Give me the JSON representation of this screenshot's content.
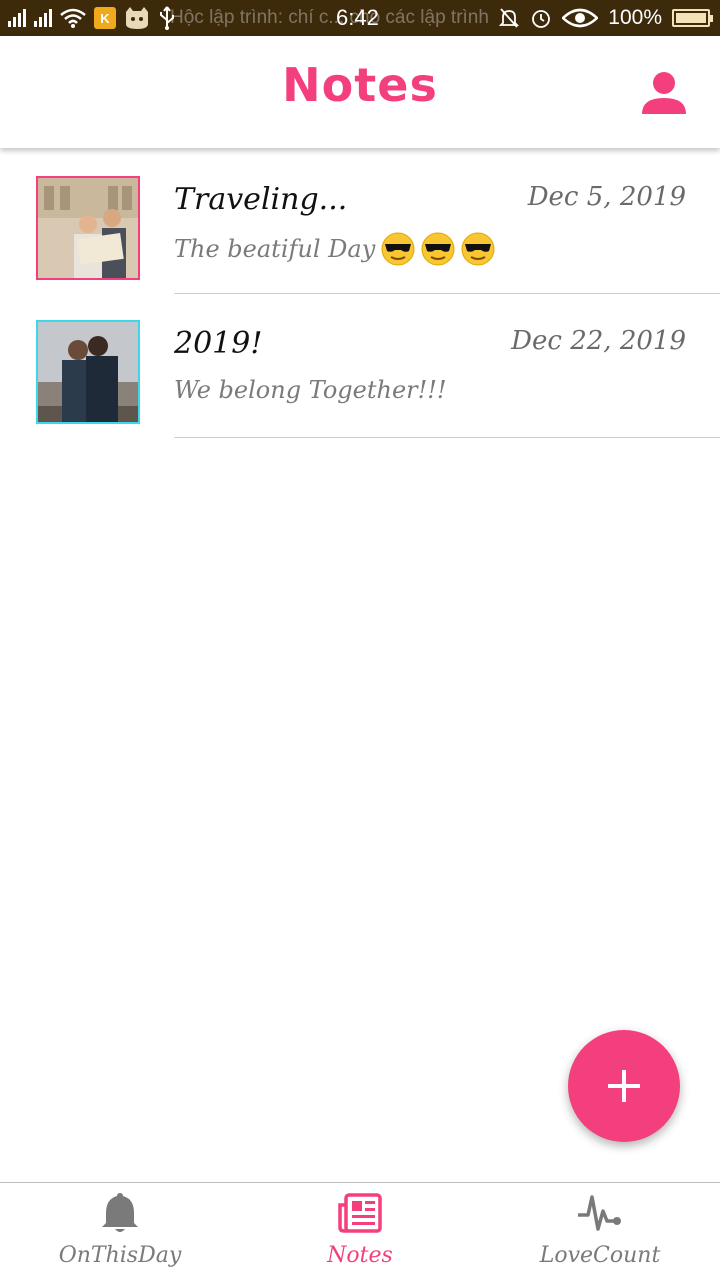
{
  "status_bar": {
    "ticker": "Hộc lập trình: chí c...  cho các lập trình",
    "time": "6:42",
    "battery_pct": "100%",
    "battery_level": 1.0
  },
  "app_bar": {
    "title": "Notes",
    "profile_icon": "person-icon"
  },
  "notes": [
    {
      "title": "Traveling...",
      "date": "Dec 5, 2019",
      "body": "The beatiful Day",
      "emoji_count": 3,
      "thumb_border_color": "#f43f7f"
    },
    {
      "title": "2019!",
      "date": "Dec 22, 2019",
      "body": "We belong Together!!!",
      "emoji_count": 0,
      "thumb_border_color": "#3ed6e8"
    }
  ],
  "fab": {
    "icon": "plus-icon",
    "color": "#f43f7f"
  },
  "bottom_nav": {
    "items": [
      {
        "label": "OnThisDay",
        "icon": "bell-icon",
        "active": false
      },
      {
        "label": "Notes",
        "icon": "newspaper-icon",
        "active": true
      },
      {
        "label": "LoveCount",
        "icon": "heartbeat-icon",
        "active": false
      }
    ]
  },
  "colors": {
    "accent": "#f43f7f",
    "inactive": "#7a7a7a",
    "status_bar": "#3d2a0b"
  }
}
